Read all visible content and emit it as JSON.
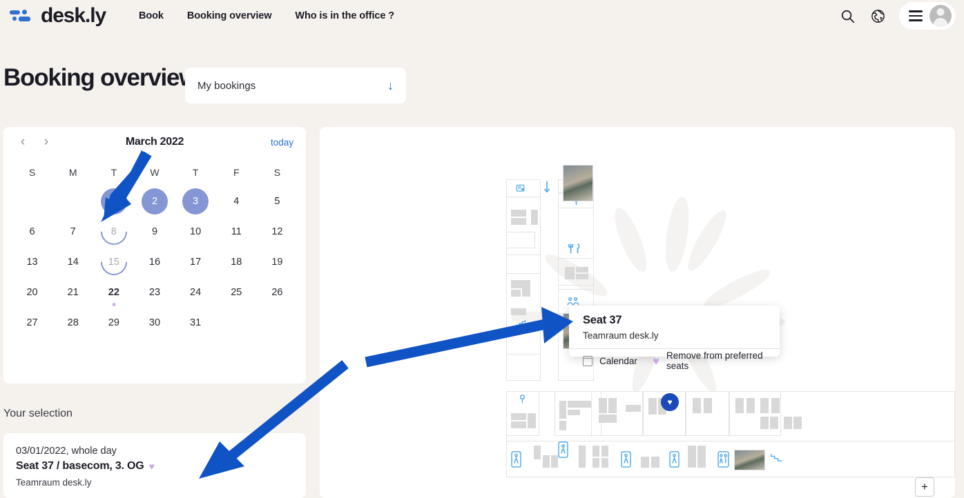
{
  "brand": {
    "name": "desk.ly",
    "logo_color": "#2f6fd0"
  },
  "nav": {
    "links": [
      {
        "label": "Book"
      },
      {
        "label": "Booking overview"
      },
      {
        "label": "Who is in the office ?"
      }
    ],
    "icons": {
      "search": "search-icon",
      "globe": "globe-icon",
      "menu": "hamburger-icon",
      "avatar": "avatar"
    }
  },
  "header": {
    "title": "Booking overview",
    "filter": {
      "value": "My bookings",
      "arrow": "↓"
    }
  },
  "calendar": {
    "month_label": "March 2022",
    "today_label": "today",
    "prev": "‹",
    "next": "›",
    "dow": [
      "S",
      "M",
      "T",
      "W",
      "T",
      "F",
      "S"
    ],
    "lead_blanks": 2,
    "days": [
      {
        "n": "1",
        "state": "selected"
      },
      {
        "n": "2",
        "state": "selected"
      },
      {
        "n": "3",
        "state": "selected"
      },
      {
        "n": "4",
        "state": "normal"
      },
      {
        "n": "5",
        "state": "normal"
      },
      {
        "n": "6",
        "state": "normal"
      },
      {
        "n": "7",
        "state": "normal"
      },
      {
        "n": "8",
        "state": "arc"
      },
      {
        "n": "9",
        "state": "normal"
      },
      {
        "n": "10",
        "state": "normal"
      },
      {
        "n": "11",
        "state": "normal"
      },
      {
        "n": "12",
        "state": "normal"
      },
      {
        "n": "13",
        "state": "normal"
      },
      {
        "n": "14",
        "state": "normal"
      },
      {
        "n": "15",
        "state": "arc"
      },
      {
        "n": "16",
        "state": "normal"
      },
      {
        "n": "17",
        "state": "normal"
      },
      {
        "n": "18",
        "state": "normal"
      },
      {
        "n": "19",
        "state": "normal"
      },
      {
        "n": "20",
        "state": "normal"
      },
      {
        "n": "21",
        "state": "normal"
      },
      {
        "n": "22",
        "state": "today"
      },
      {
        "n": "23",
        "state": "normal"
      },
      {
        "n": "24",
        "state": "normal"
      },
      {
        "n": "25",
        "state": "normal"
      },
      {
        "n": "26",
        "state": "normal"
      },
      {
        "n": "27",
        "state": "normal"
      },
      {
        "n": "28",
        "state": "normal"
      },
      {
        "n": "29",
        "state": "normal"
      },
      {
        "n": "30",
        "state": "normal"
      },
      {
        "n": "31",
        "state": "normal"
      }
    ],
    "colors": {
      "selected_bg": "#8496d4",
      "accent": "#2f6fd0",
      "today_dot": "#cdb3e6"
    }
  },
  "selection": {
    "heading": "Your selection",
    "date": "03/01/2022, whole day",
    "seat": "Seat 37 / basecom, 3. OG",
    "heart": "♥",
    "room": "Teamraum desk.ly"
  },
  "tooltip": {
    "title": "Seat 37",
    "subtitle": "Teamraum desk.ly",
    "calendar_label": "Calendar",
    "heart": "♥",
    "remove_label": "Remove from preferred seats",
    "heart_color": "#c9a7e8"
  },
  "map": {
    "favorite_pin": "♥",
    "zoom_in_label": "+",
    "icons": [
      "printer-icon",
      "arrow-down-icon",
      "lamp-icon",
      "lamp-icon",
      "cutlery-icon",
      "meeting-icon",
      "stairs-icon",
      "plug-icon",
      "restroom-icon",
      "restroom-icon",
      "restroom-icon",
      "restroom-icon",
      "restroom-icon",
      "stairs-icon"
    ]
  }
}
